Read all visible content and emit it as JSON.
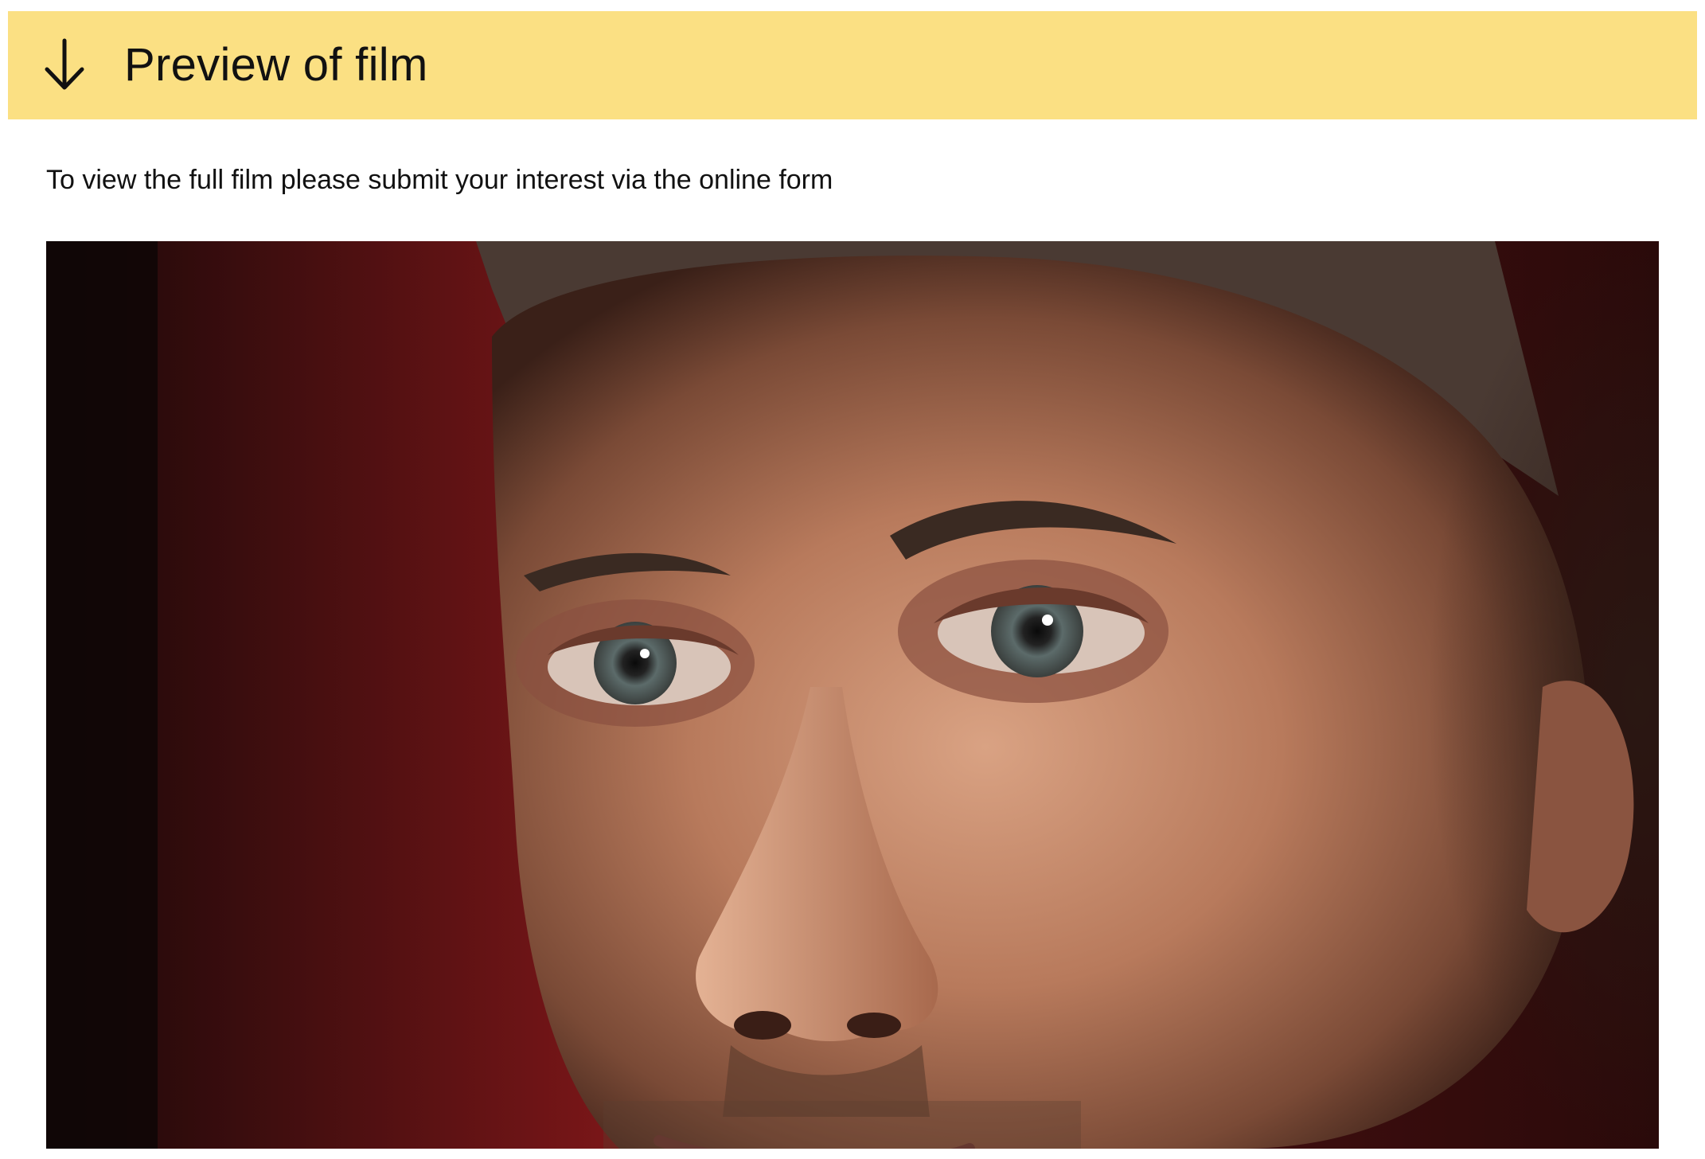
{
  "banner": {
    "title": "Preview of film",
    "icon": "arrow-down-icon",
    "background_color": "#FBE083"
  },
  "notice": {
    "text": "To view the full film please submit your interest via the online form"
  },
  "video": {
    "poster": "close-up-face-still",
    "colors": {
      "curtain": "#7a1618",
      "skin": "#b87a5c",
      "shadow": "#1a0c0b"
    }
  }
}
